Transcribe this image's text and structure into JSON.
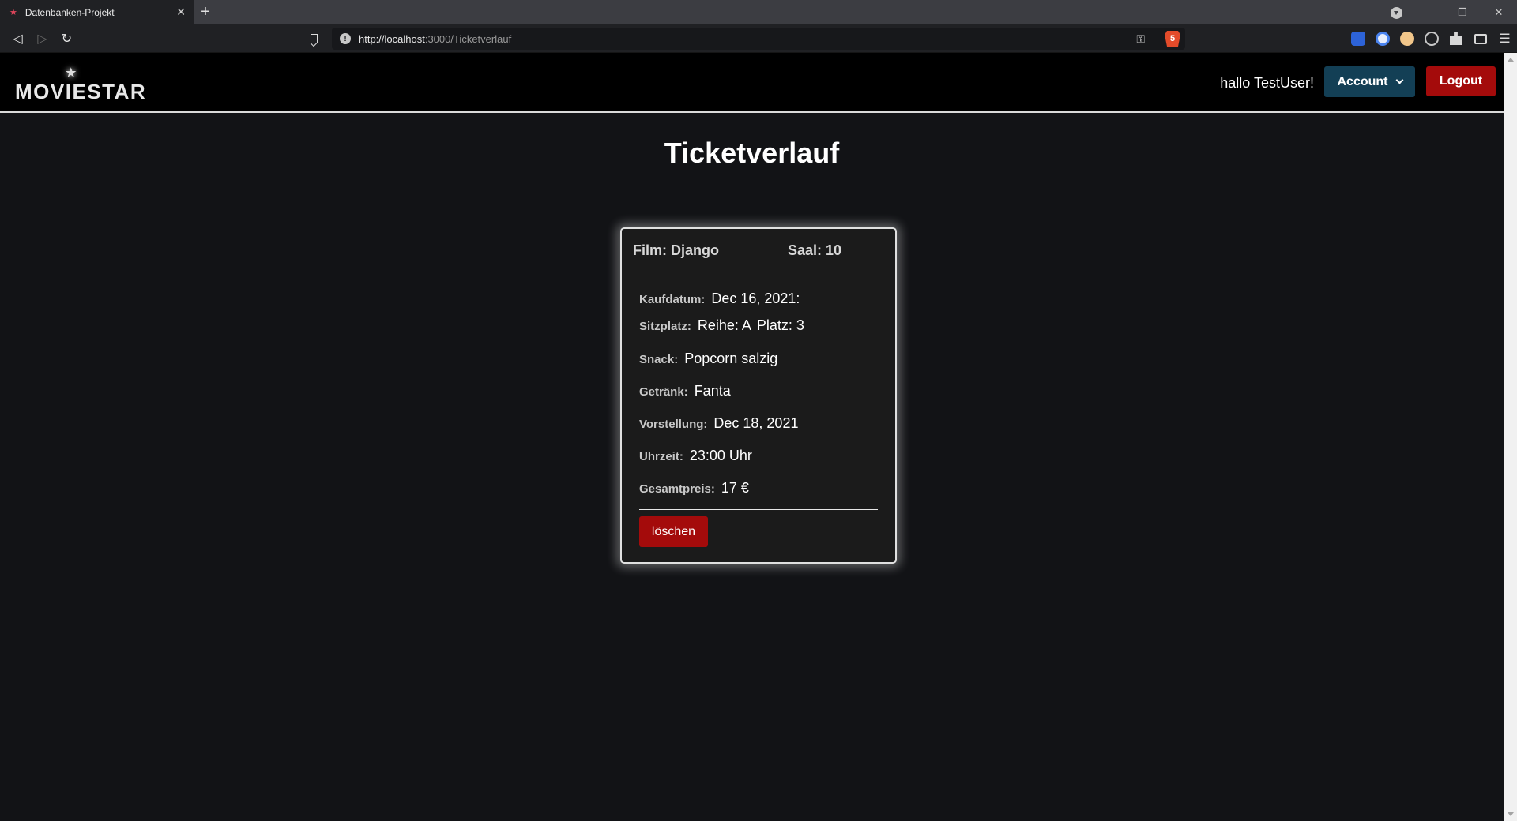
{
  "browser": {
    "tab_title": "Datenbanken-Projekt",
    "tab_close": "✕",
    "new_tab": "+",
    "url_host": "http://localhost",
    "url_rest": ":3000/Ticketverlauf",
    "window_controls": {
      "minimize": "–",
      "maximize": "❐",
      "close": "✕"
    },
    "brave_shields_count": "5"
  },
  "navbar": {
    "logo_text": "MOVIESTAR",
    "greeting": "hallo TestUser!",
    "account_label": "Account",
    "logout_label": "Logout"
  },
  "page": {
    "title": "Ticketverlauf"
  },
  "ticket": {
    "film_label": "Film:",
    "film_value": "Django",
    "saal_label": "Saal:",
    "saal_value": "10",
    "kaufdatum_label": "Kaufdatum:",
    "kaufdatum_value": "Dec 16, 2021:",
    "sitzplatz_label": "Sitzplatz:",
    "sitzplatz_reihe": "Reihe: A",
    "sitzplatz_platz": "Platz: 3",
    "snack_label": "Snack:",
    "snack_value": "Popcorn salzig",
    "getraenk_label": "Getränk:",
    "getraenk_value": "Fanta",
    "vorstellung_label": "Vorstellung:",
    "vorstellung_value": "Dec 18, 2021",
    "uhrzeit_label": "Uhrzeit:",
    "uhrzeit_value": "23:00 Uhr",
    "gesamtpreis_label": "Gesamtpreis:",
    "gesamtpreis_value": "17 €",
    "delete_label": "löschen"
  },
  "colors": {
    "background": "#121316",
    "navbar": "#000000",
    "account_button": "#133f55",
    "danger_button": "#a40b0b"
  }
}
